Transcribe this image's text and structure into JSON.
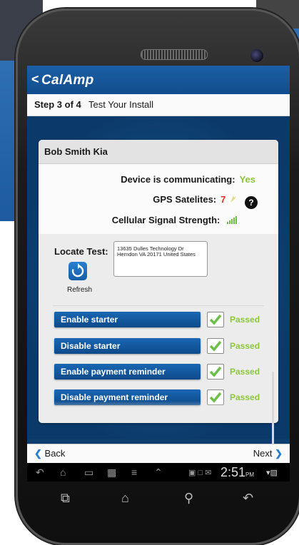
{
  "app": {
    "brand": "CalAmp",
    "back_chevron": "<"
  },
  "step": {
    "number": "Step 3 of 4",
    "title": "Test Your Install"
  },
  "card": {
    "title": "Bob Smith Kia",
    "status": [
      {
        "label": "Device is communicating:",
        "value": "Yes",
        "value_color": "#8cc63f"
      },
      {
        "label": "GPS Satelites:",
        "value": "7",
        "value_color": "#d9342b",
        "icon": "satellite-icon"
      },
      {
        "label": "Cellular Signal Strength:",
        "value": "",
        "icon": "signal-bars-icon"
      }
    ],
    "help_icon": "?",
    "locate": {
      "label": "Locate Test:",
      "address": "13635 Dulles Technology Dr Herndon VA 20171 United States",
      "refresh_label": "Refresh"
    },
    "actions": [
      {
        "label": "Enable starter",
        "result": "Passed"
      },
      {
        "label": "Disable starter",
        "result": "Passed"
      },
      {
        "label": "Enable payment reminder",
        "result": "Passed"
      },
      {
        "label": "Disable payment reminder",
        "result": "Passed"
      }
    ]
  },
  "nav": {
    "back": "Back",
    "next": "Next"
  },
  "system": {
    "time": "2:51",
    "ampm": "PM"
  },
  "colors": {
    "brand_blue": "#1c5fa5",
    "success_green": "#8cc63f",
    "alert_red": "#d9342b"
  }
}
